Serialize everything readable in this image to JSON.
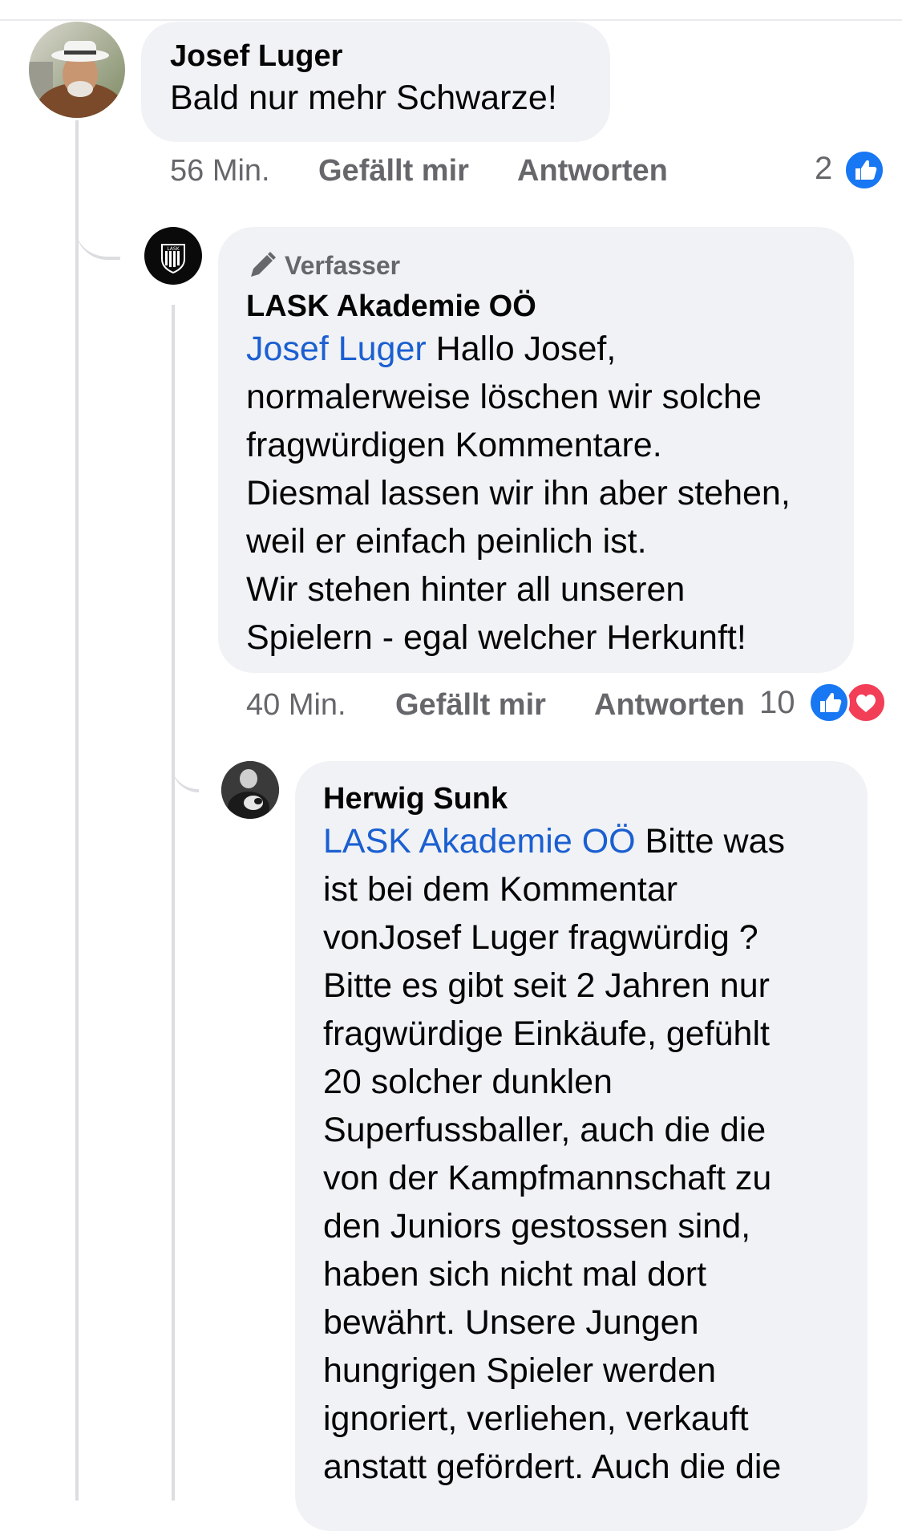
{
  "comments": [
    {
      "author": "Josef Luger",
      "text": "Bald nur mehr Schwarze!",
      "time": "56 Min.",
      "like_label": "Gefällt mir",
      "reply_label": "Antworten",
      "reaction_count": "2"
    },
    {
      "badge": "Verfasser",
      "author": "LASK Akademie OÖ",
      "mention": "Josef Luger",
      "text_lines": [
        " Hallo Josef,",
        "normalerweise löschen wir solche",
        "fragwürdigen Kommentare.",
        "Diesmal lassen wir ihn aber stehen,",
        "weil er einfach peinlich ist.",
        "Wir stehen hinter all unseren",
        "Spielern - egal welcher Herkunft!"
      ],
      "time": "40 Min.",
      "like_label": "Gefällt mir",
      "reply_label": "Antworten",
      "reaction_count": "10",
      "logo_text": "LASK"
    },
    {
      "author": "Herwig Sunk",
      "mention": "LASK Akademie OÖ",
      "text_lines": [
        " Bitte was",
        "ist bei dem Kommentar",
        "vonJosef Luger fragwürdig ?",
        "Bitte es gibt seit 2 Jahren nur",
        "fragwürdige Einkäufe, gefühlt",
        "20 solcher dunklen",
        "Superfussballer, auch die die",
        "von der Kampfmannschaft zu",
        "den Juniors gestossen sind,",
        "haben sich nicht mal dort",
        "bewährt. Unsere Jungen",
        "hungrigen Spieler werden",
        "ignoriert, verliehen, verkauft",
        "anstatt gefördert. Auch die die"
      ]
    }
  ],
  "colors": {
    "bubble": "#f0f2f5",
    "mention": "#1b5fd1",
    "meta": "#65676b",
    "like_blue": "#1877f2",
    "love_red": "#f33e58"
  },
  "icons": [
    "thumbs-up-icon",
    "heart-icon",
    "pencil-icon"
  ]
}
